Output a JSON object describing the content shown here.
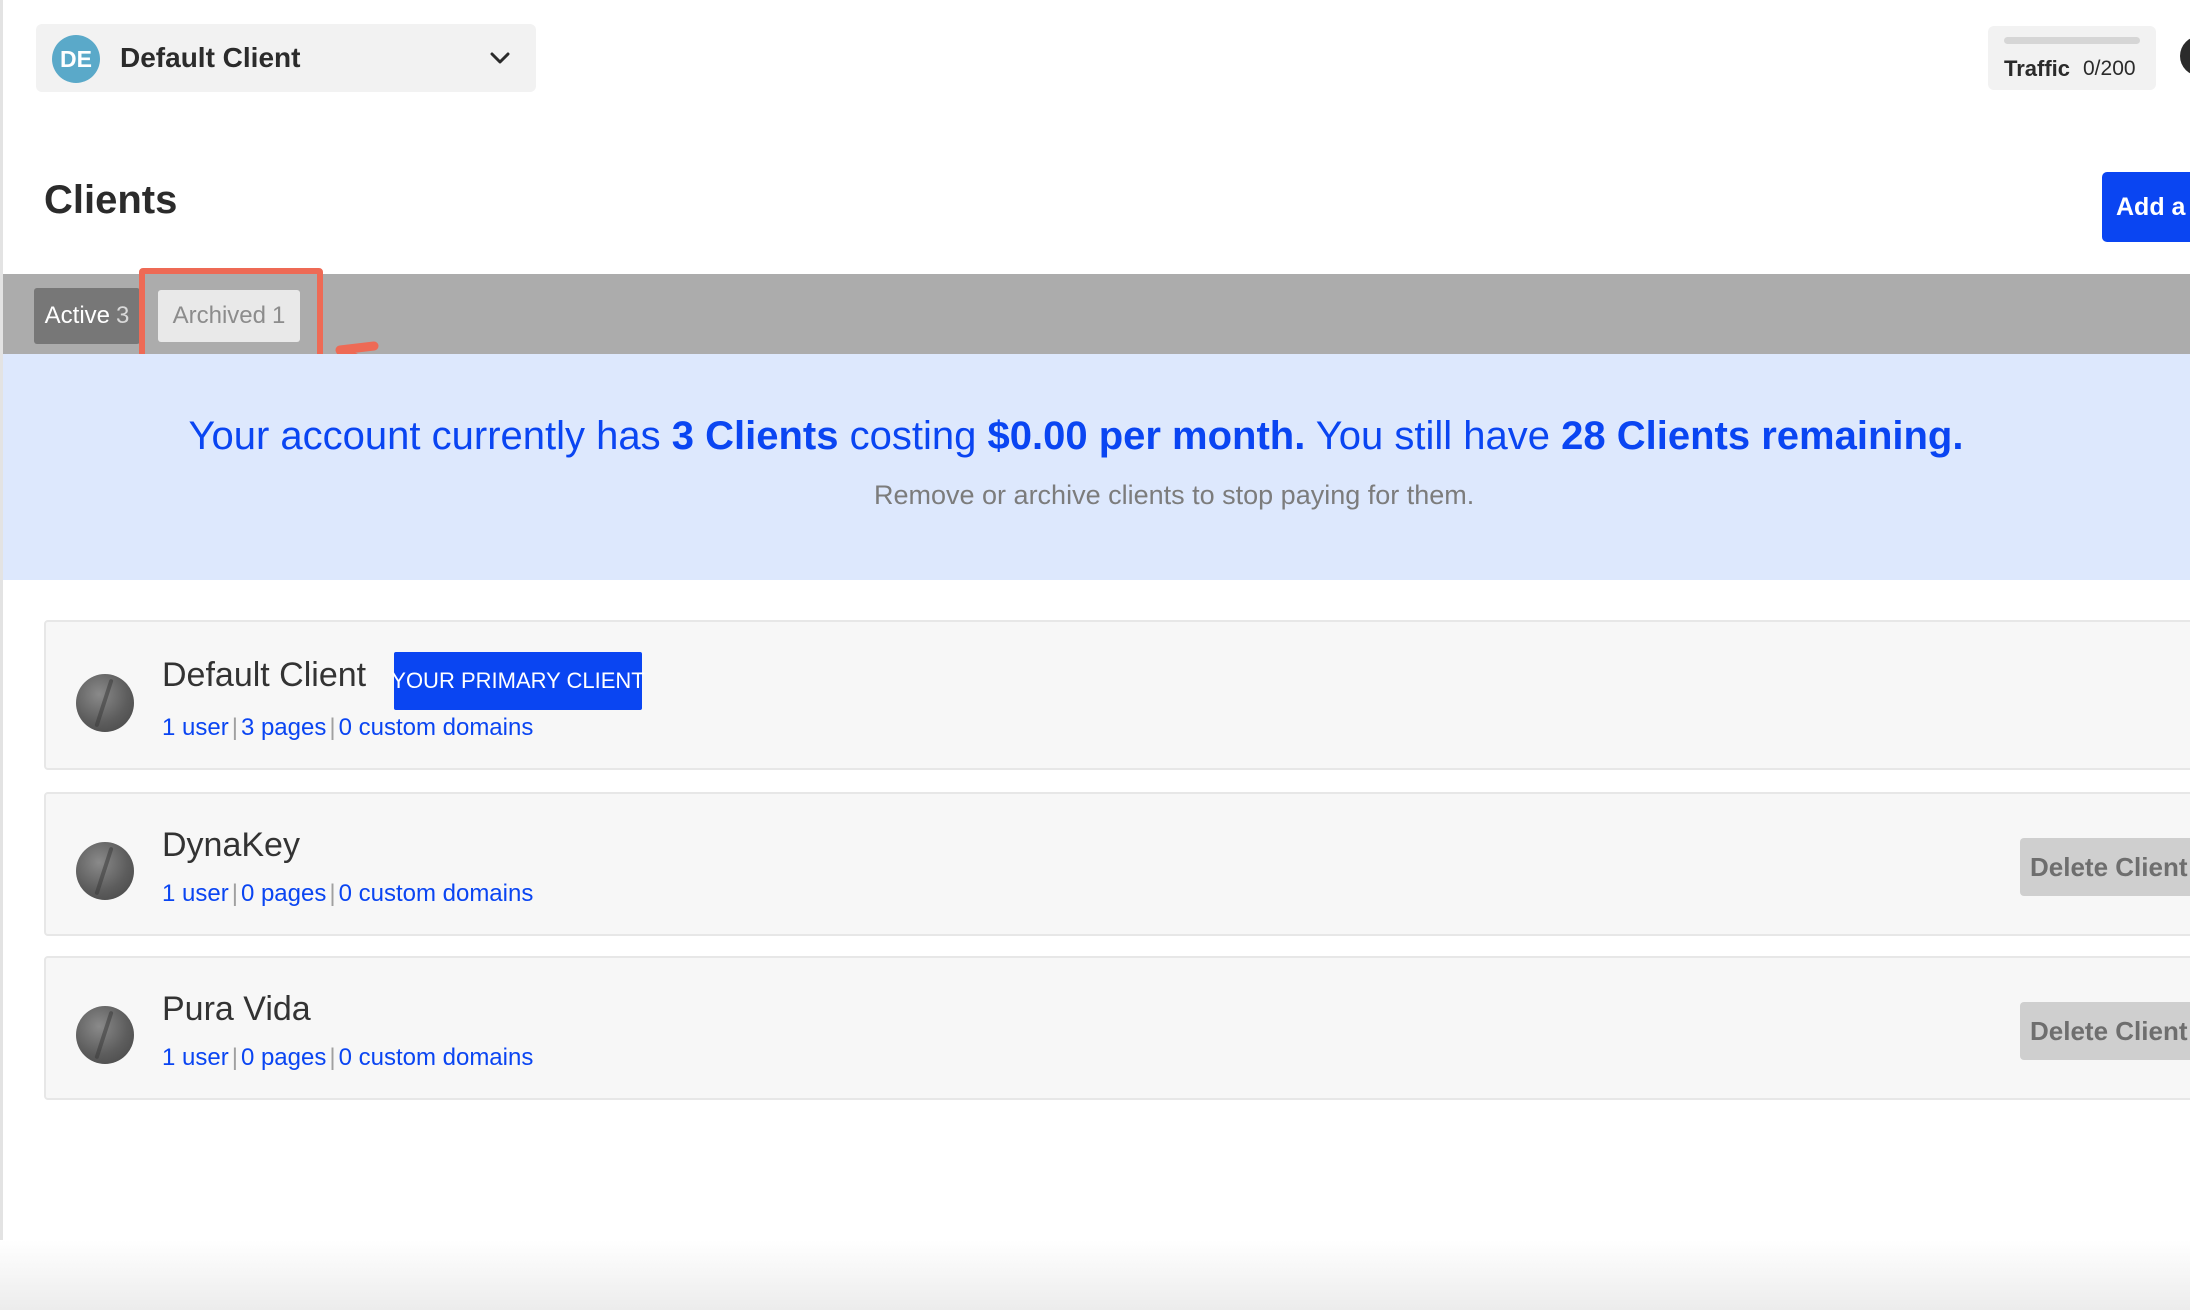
{
  "header": {
    "client_switcher": {
      "initials": "DE",
      "name": "Default Client",
      "avatar_color": "#5aa9c9"
    },
    "traffic": {
      "label": "Traffic",
      "count": "0/200",
      "fill_fraction": 0
    }
  },
  "page": {
    "title": "Clients",
    "add_button_label": "Add a"
  },
  "tabs": [
    {
      "label": "Active",
      "count": "3"
    },
    {
      "label": "Archived",
      "count": "1"
    }
  ],
  "banner": {
    "p1": "Your account currently has",
    "clients": "3 Clients",
    "p2": "costing",
    "cost": "$0.00 per month.",
    "p3": "You still have",
    "remaining": "28 Clients remaining.",
    "subtext": "Remove or archive clients to stop paying for them."
  },
  "clients": [
    {
      "name": "Default Client",
      "badge": "YOUR PRIMARY CLIENT",
      "users": "1 user",
      "pages": "3 pages",
      "domains": "0 custom domains"
    },
    {
      "name": "DynaKey",
      "users": "1 user",
      "pages": "0 pages",
      "domains": "0 custom domains",
      "delete_label": "Delete Client"
    },
    {
      "name": "Pura Vida",
      "users": "1 user",
      "pages": "0 pages",
      "domains": "0 custom domains",
      "delete_label": "Delete Client"
    }
  ],
  "colors": {
    "accent": "#0a45f2",
    "highlight": "#ee6a55",
    "banner_bg": "#dde8fd",
    "tab_band": "#acacac"
  },
  "icons": [
    "chevron-down-icon",
    "client-globe-icon",
    "annotation-arrow-icon"
  ]
}
